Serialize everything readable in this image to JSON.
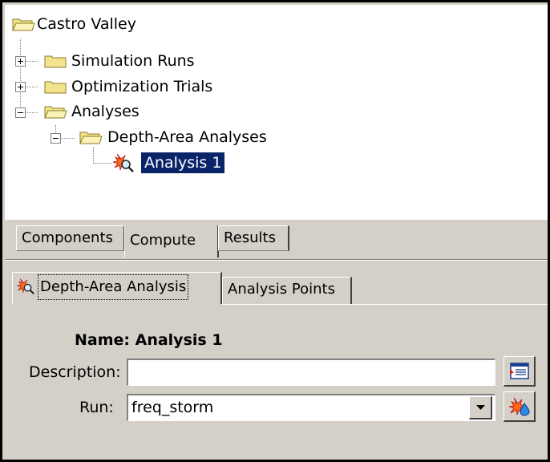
{
  "tree": {
    "root": "Castro Valley",
    "items": [
      {
        "label": "Simulation Runs"
      },
      {
        "label": "Optimization Trials"
      },
      {
        "label": "Analyses"
      },
      {
        "label": "Depth-Area Analyses"
      },
      {
        "label": "Analysis 1"
      }
    ]
  },
  "main_tabs": [
    "Components",
    "Compute",
    "Results"
  ],
  "sub_tabs": [
    "Depth-Area Analysis",
    "Analysis Points"
  ],
  "form": {
    "name_text": "Name: Analysis 1",
    "description_label": "Description:",
    "description_value": "",
    "run_label": "Run:",
    "run_value": "freq_storm"
  },
  "colors": {
    "selection": "#0a246a",
    "panel": "#d4d0c8",
    "folder": "#f3e38c"
  },
  "icons": {
    "description_button": "edit-description-icon",
    "run_button": "run-compute-icon",
    "analysis": "depth-area-analysis-icon"
  }
}
